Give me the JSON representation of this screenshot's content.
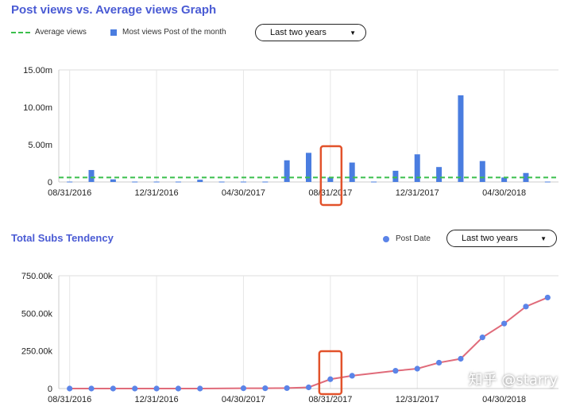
{
  "chart1": {
    "title": "Post views vs. Average views Graph",
    "legend_avg": "Average views",
    "legend_bar": "Most views Post of the month",
    "dropdown": "Last two years"
  },
  "chart2": {
    "title": "Total Subs Tendency",
    "legend_dot": "Post Date",
    "dropdown": "Last two years"
  },
  "watermark": "知乎 @starry",
  "colors": {
    "title": "#4a5bd4",
    "bar": "#4a7de0",
    "average": "#3bbf4c",
    "line": "#e06b7a",
    "dot": "#5b84e8",
    "highlight": "#e2522b"
  },
  "chart_data": [
    {
      "type": "bar",
      "title": "Post views vs. Average views Graph",
      "xlabel": "",
      "ylabel": "",
      "ylim": [
        0,
        15
      ],
      "y_ticks": [
        "0",
        "5.00m",
        "10.00m",
        "15.00m"
      ],
      "x_ticks": [
        "08/31/2016",
        "12/31/2016",
        "04/30/2017",
        "08/31/2017",
        "12/31/2017",
        "04/30/2018"
      ],
      "average_value": 0.6,
      "series": [
        {
          "name": "Most views Post of the month",
          "points": [
            {
              "x": "2016-08",
              "y": 0.05
            },
            {
              "x": "2016-09",
              "y": 1.6
            },
            {
              "x": "2016-10",
              "y": 0.35
            },
            {
              "x": "2016-11",
              "y": 0.05
            },
            {
              "x": "2016-12",
              "y": 0.05
            },
            {
              "x": "2017-01",
              "y": 0.05
            },
            {
              "x": "2017-02",
              "y": 0.3
            },
            {
              "x": "2017-03",
              "y": 0.05
            },
            {
              "x": "2017-04",
              "y": 0.05
            },
            {
              "x": "2017-05",
              "y": 0.05
            },
            {
              "x": "2017-06",
              "y": 2.9
            },
            {
              "x": "2017-07",
              "y": 3.9
            },
            {
              "x": "2017-08",
              "y": 0.6
            },
            {
              "x": "2017-09",
              "y": 2.6
            },
            {
              "x": "2017-10",
              "y": 0.05
            },
            {
              "x": "2017-11",
              "y": 1.5
            },
            {
              "x": "2017-12",
              "y": 3.7
            },
            {
              "x": "2018-01",
              "y": 2.0
            },
            {
              "x": "2018-02",
              "y": 11.6
            },
            {
              "x": "2018-03",
              "y": 2.8
            },
            {
              "x": "2018-04",
              "y": 0.6
            },
            {
              "x": "2018-05",
              "y": 1.2
            },
            {
              "x": "2018-06",
              "y": 0.05
            }
          ]
        }
      ]
    },
    {
      "type": "line",
      "title": "Total Subs Tendency",
      "xlabel": "",
      "ylabel": "",
      "ylim": [
        0,
        750
      ],
      "y_ticks": [
        "0",
        "250.00k",
        "500.00k",
        "750.00k"
      ],
      "x_ticks": [
        "08/31/2016",
        "12/31/2016",
        "04/30/2017",
        "08/31/2017",
        "12/31/2017",
        "04/30/2018"
      ],
      "series": [
        {
          "name": "Post Date",
          "points": [
            {
              "x": "2016-08",
              "y": 0
            },
            {
              "x": "2016-09",
              "y": 0
            },
            {
              "x": "2016-10",
              "y": 0
            },
            {
              "x": "2016-11",
              "y": 0
            },
            {
              "x": "2016-12",
              "y": 0
            },
            {
              "x": "2017-01",
              "y": 0
            },
            {
              "x": "2017-02",
              "y": 0
            },
            {
              "x": "2017-04",
              "y": 2
            },
            {
              "x": "2017-05",
              "y": 2
            },
            {
              "x": "2017-06",
              "y": 3
            },
            {
              "x": "2017-07",
              "y": 8
            },
            {
              "x": "2017-08",
              "y": 62
            },
            {
              "x": "2017-09",
              "y": 85
            },
            {
              "x": "2017-11",
              "y": 118
            },
            {
              "x": "2017-12",
              "y": 132
            },
            {
              "x": "2018-01",
              "y": 172
            },
            {
              "x": "2018-02",
              "y": 198
            },
            {
              "x": "2018-03",
              "y": 340
            },
            {
              "x": "2018-04",
              "y": 432
            },
            {
              "x": "2018-05",
              "y": 545
            },
            {
              "x": "2018-06",
              "y": 605
            }
          ]
        }
      ]
    }
  ]
}
